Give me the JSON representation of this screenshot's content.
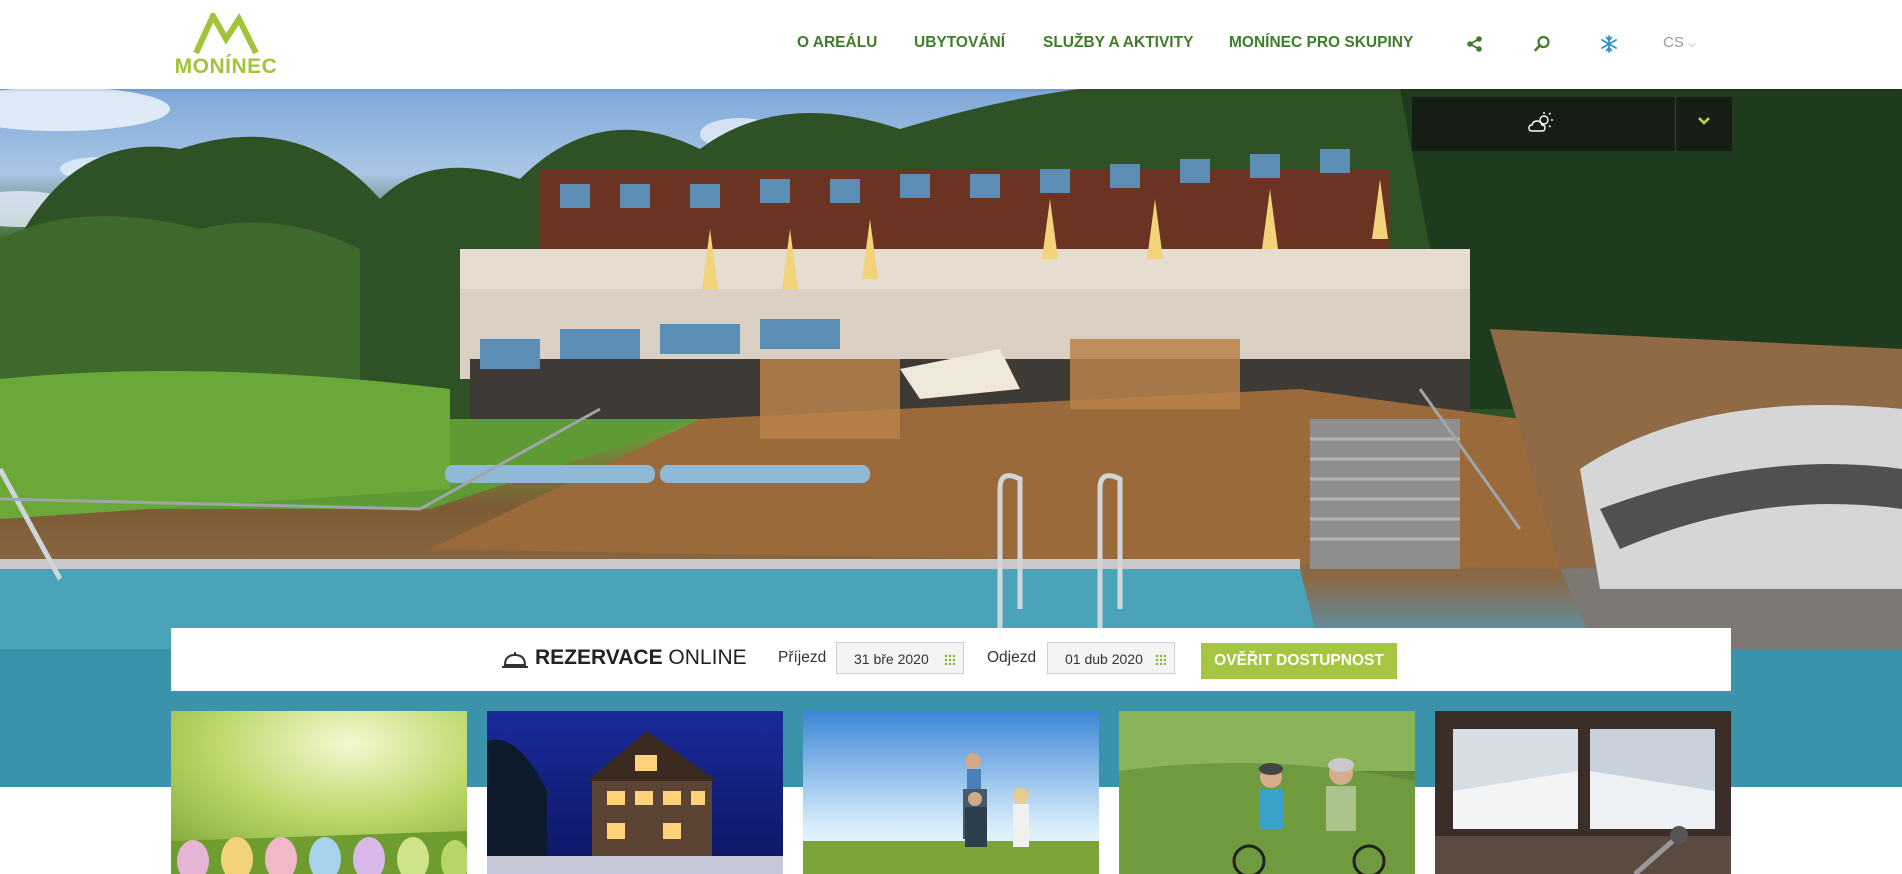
{
  "brand": {
    "logo_text": "MONÍNEC",
    "color": "#a3c33a",
    "nav_color": "#3f7d2a"
  },
  "nav": {
    "items": [
      {
        "label": "O AREÁLU"
      },
      {
        "label": "UBYTOVÁNÍ"
      },
      {
        "label": "SLUŽBY A AKTIVITY"
      },
      {
        "label": "MONÍNEC PRO SKUPINY"
      }
    ],
    "icons": [
      "share-icon",
      "search-icon",
      "snowflake-icon"
    ],
    "language": "CS"
  },
  "weather": {
    "icon": "cloud-sun-icon",
    "toggle_icon": "chevron-down-icon"
  },
  "booking": {
    "title_bold": "REZERVACE",
    "title_rest": " ONLINE",
    "arrival_label": "Příjezd",
    "arrival_value": "31 bře 2020",
    "departure_label": "Odjezd",
    "departure_value": "01 dub 2020",
    "submit_label": "OVĚŘIT DOSTUPNOST",
    "accent": "#a6c543"
  },
  "cards": [
    {
      "subject": "easter eggs on grass"
    },
    {
      "subject": "chalet at night"
    },
    {
      "subject": "family in meadow"
    },
    {
      "subject": "cyclists"
    },
    {
      "subject": "ski slope through window"
    }
  ]
}
